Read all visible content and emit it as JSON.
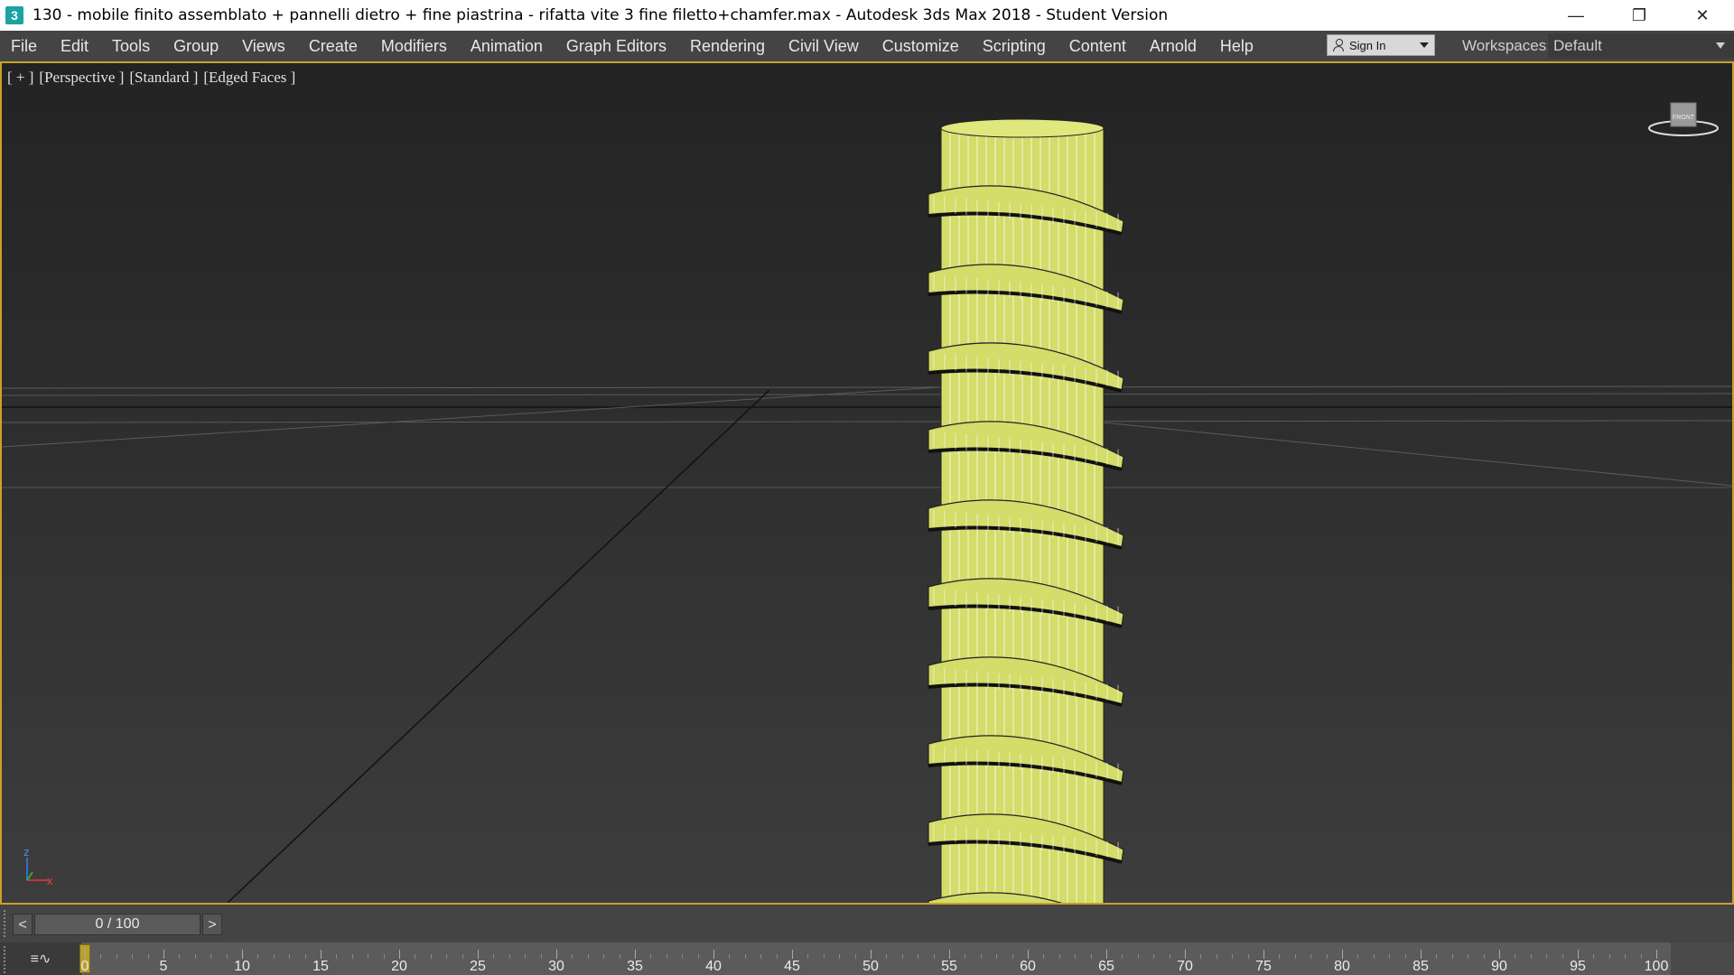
{
  "window": {
    "icon_text": "3",
    "title": "130 -  mobile finito assemblato + pannelli dietro + fine piastrina - rifatta vite 3 fine filetto+chamfer.max - Autodesk 3ds Max 2018 - Student Version",
    "minimize_glyph": "—",
    "restore_glyph": "❐",
    "close_glyph": "✕"
  },
  "menu": {
    "items": [
      "File",
      "Edit",
      "Tools",
      "Group",
      "Views",
      "Create",
      "Modifiers",
      "Animation",
      "Graph Editors",
      "Rendering",
      "Civil View",
      "Customize",
      "Scripting",
      "Content",
      "Arnold",
      "Help"
    ]
  },
  "account": {
    "sign_in_label": "Sign In"
  },
  "workspaces": {
    "label": "Workspaces:",
    "value": "Default"
  },
  "viewport": {
    "labels": [
      "[ + ]",
      "[Perspective ]",
      "[Standard ]",
      "[Edged Faces ]"
    ],
    "viewcube_label": "FRONT",
    "axis_z": "z",
    "axis_x": "x",
    "object_color": "#d4dc6a",
    "border_color": "#c9a227"
  },
  "timeline": {
    "prev_label": "<",
    "next_label": ">",
    "frame_display": "0 / 100",
    "current_frame": 0,
    "start": 0,
    "end": 100,
    "tick_labels": [
      "0",
      "5",
      "10",
      "15",
      "20",
      "25",
      "30",
      "35",
      "40",
      "45",
      "50",
      "55",
      "60",
      "65",
      "70",
      "75",
      "80",
      "85",
      "90",
      "95",
      "100"
    ],
    "curve_icon_text": "≡∿"
  }
}
